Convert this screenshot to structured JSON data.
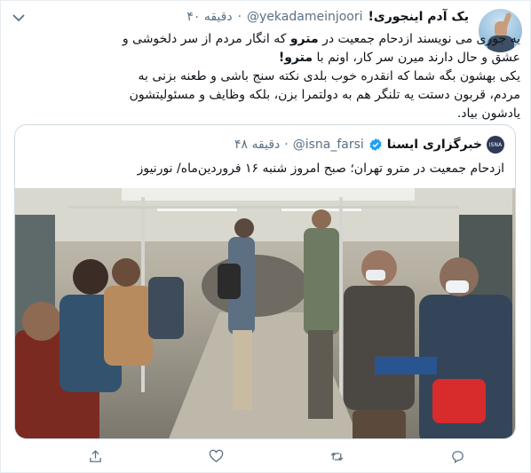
{
  "tweet": {
    "display_name": "یک آدم اینجوری!",
    "handle": "@yekadameinjoori",
    "separator": "·",
    "time": "۴۰ دقیقه",
    "text_lines": [
      "یه جوری می نویسند ازدحام جمعیت در مترو که انگار مردم از سر دلخوشی و",
      "عشق و حال دارند میرن سر کار، اونم با مترو!",
      "یکی بهشون بگه شما که انقدره خوب بلدی نکته سنج باشی و طعنه بزنی به",
      "مردم، قربون دستت یه تلنگر هم به دولتمرا بزن، بلکه وظایف و مسئولیتشون",
      "یادشون بیاد."
    ],
    "highlights": [
      "مترو",
      "مترو!"
    ]
  },
  "quoted": {
    "avatar_text": "ISNA",
    "display_name": "خبرگزاری ایسنا",
    "handle": "@isna_farsi",
    "separator": "·",
    "time": "۴۸ دقیقه",
    "text": "ازدحام جمعیت در مترو تهران؛ صبح امروز شنبه ۱۶ فروردین‌ماه/ نورنیوز"
  },
  "icons": {
    "caret": "chevron-down-icon",
    "verified": "verified-badge-icon",
    "actions": [
      "comment-icon",
      "retweet-icon",
      "like-icon",
      "share-icon"
    ]
  },
  "colors": {
    "text": "#0f1419",
    "muted": "#5b7083",
    "verified_blue": "#1da1f2",
    "border": "#cfd9de"
  }
}
